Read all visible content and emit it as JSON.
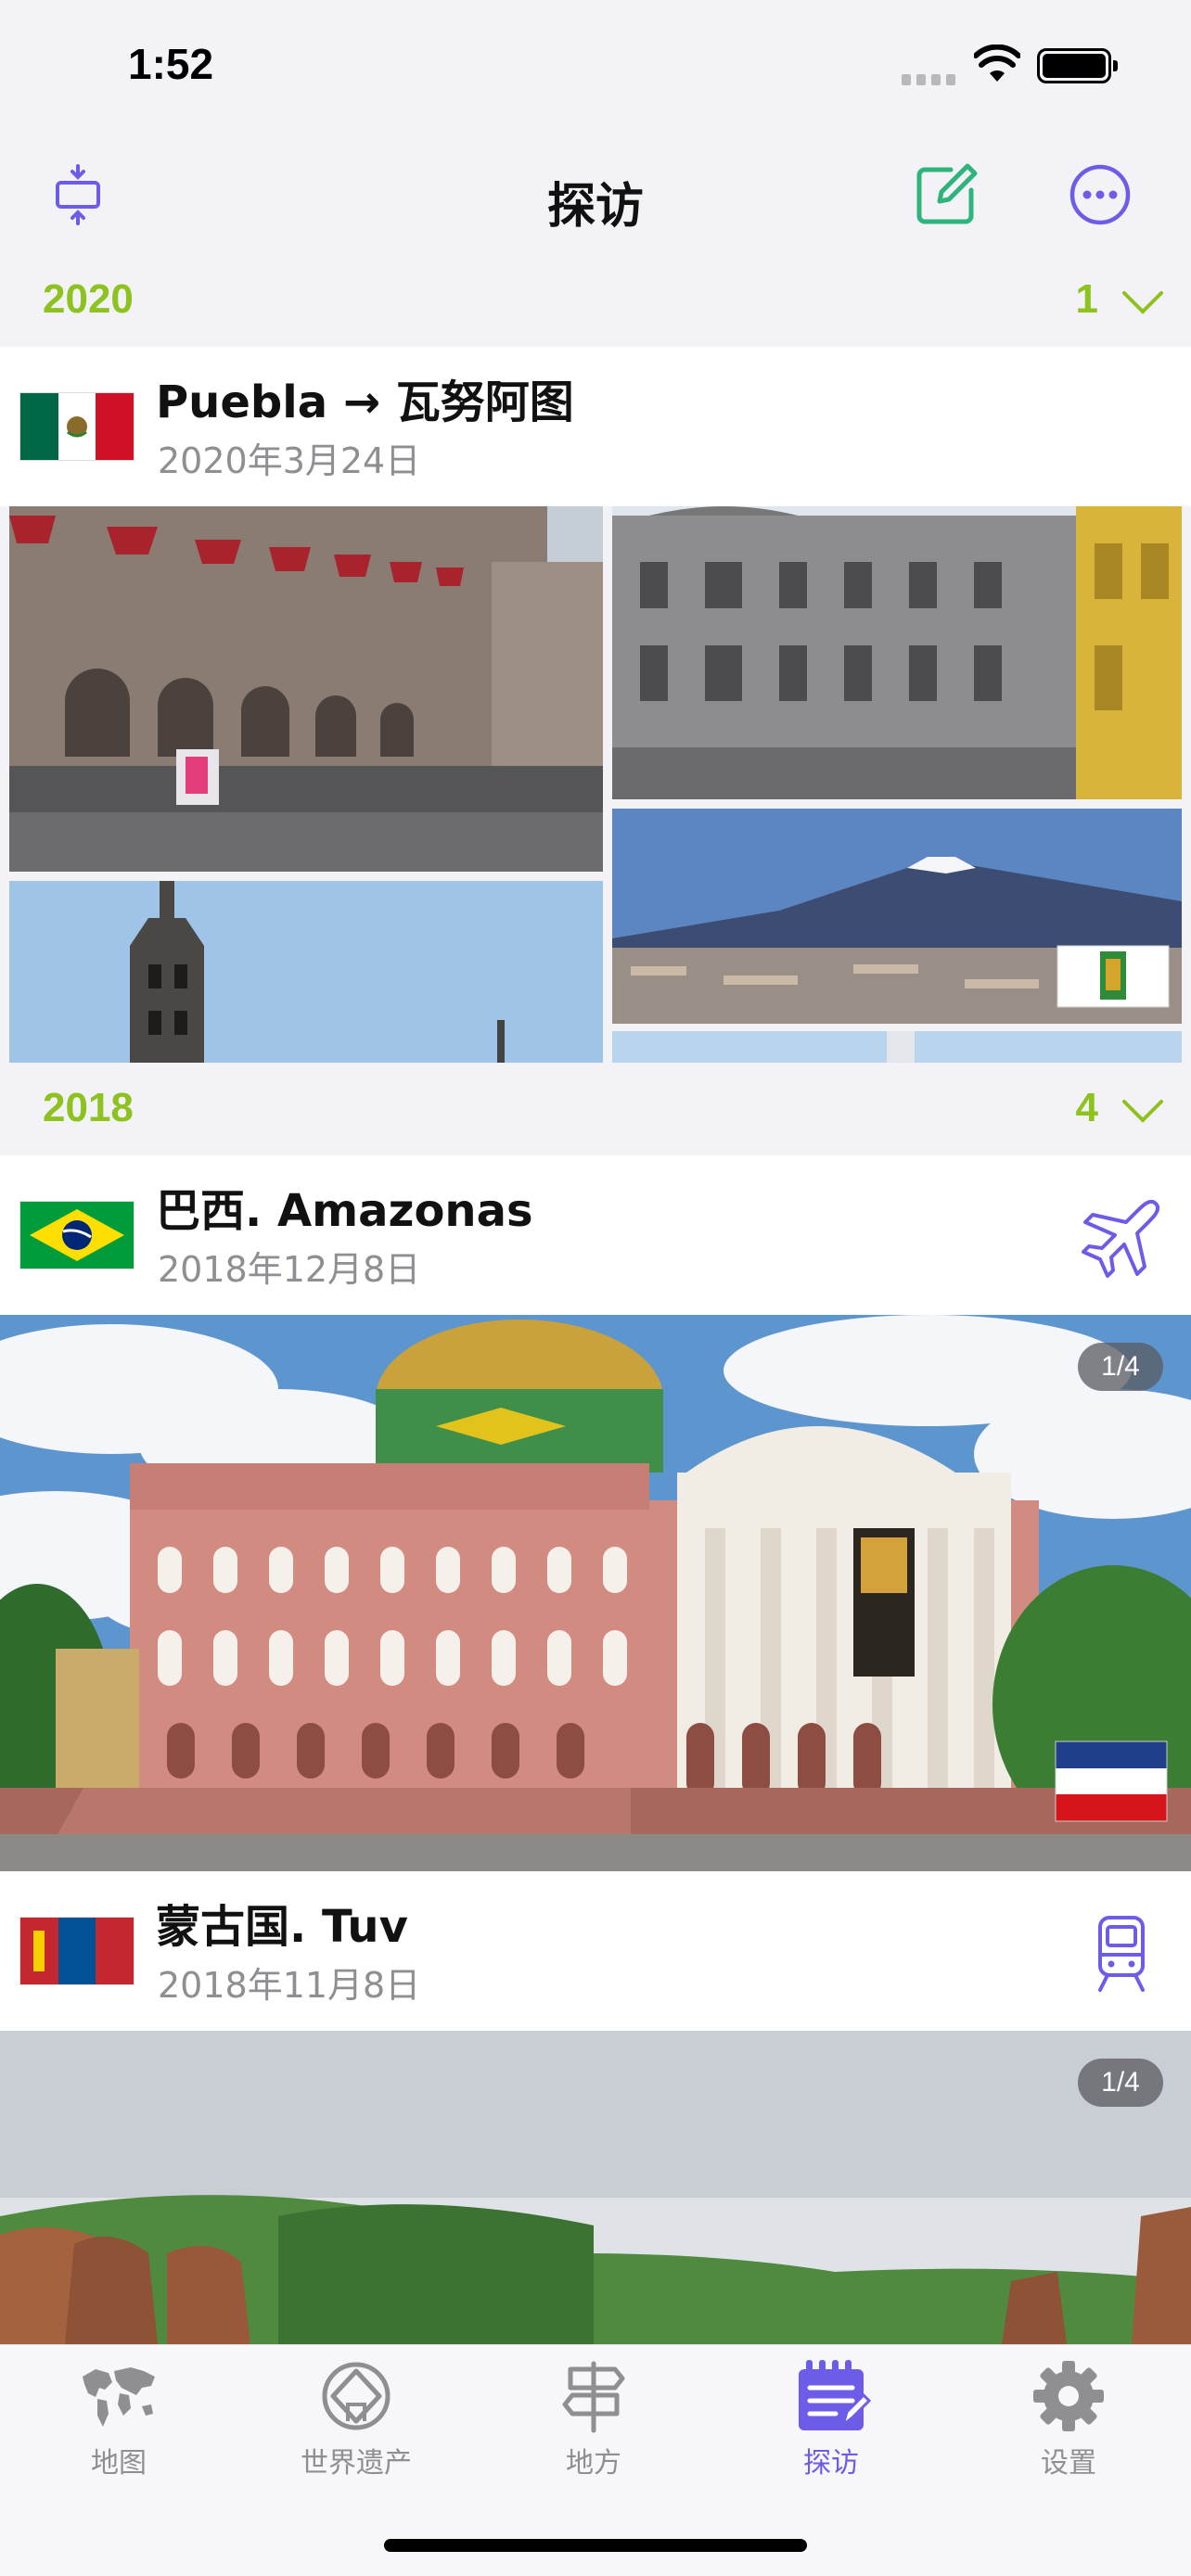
{
  "status_bar": {
    "time": "1:52"
  },
  "nav": {
    "title": "探访"
  },
  "colors": {
    "accent": "#6c5ce7",
    "year_green": "#8dc21f"
  },
  "sections": [
    {
      "year": "2020",
      "count": "1",
      "trips": [
        {
          "title": "Puebla → 瓦努阿图",
          "date": "2020年3月24日",
          "flag": "mexico-flag"
        }
      ]
    },
    {
      "year": "2018",
      "count": "4",
      "trips": [
        {
          "title": "巴西. Amazonas",
          "date": "2018年12月8日",
          "flag": "brazil-flag",
          "transport": "plane-icon",
          "page": "1/4"
        },
        {
          "title": "蒙古国. Tuv",
          "date": "2018年11月8日",
          "flag": "mongolia-flag",
          "transport": "train-icon",
          "page": "1/4"
        }
      ]
    }
  ],
  "tabs": [
    {
      "label": "地图",
      "icon": "world-map-icon"
    },
    {
      "label": "世界遗产",
      "icon": "world-heritage-icon"
    },
    {
      "label": "地方",
      "icon": "signpost-icon"
    },
    {
      "label": "探访",
      "icon": "notepad-icon",
      "active": true
    },
    {
      "label": "设置",
      "icon": "gear-icon"
    }
  ]
}
